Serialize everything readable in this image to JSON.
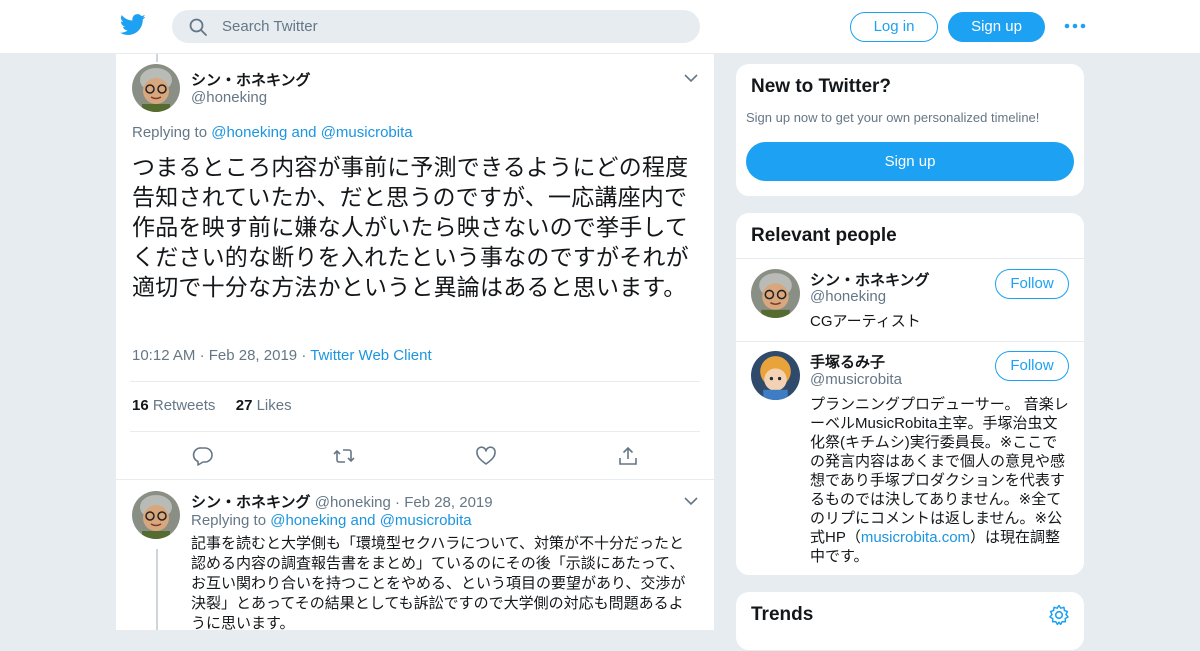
{
  "header": {
    "search_placeholder": "Search Twitter",
    "login_label": "Log in",
    "signup_label": "Sign up"
  },
  "tweet": {
    "name": "シン・ホネキング",
    "handle": "@honeking",
    "replying_prefix": "Replying to ",
    "replying_to": "@honeking and @musicrobita",
    "text": "つまるところ内容が事前に予測できるようにどの程度告知されていたか、だと思うのですが、一応講座内で作品を映す前に嫌な人がいたら映さないので挙手してください的な断りを入れたという事なのですがそれが適切で十分な方法かというと異論はあると思います。",
    "time": "10:12 AM",
    "date": "Feb 28, 2019",
    "client": "Twitter Web Client",
    "retweets_count": "16",
    "retweets_label": "Retweets",
    "likes_count": "27",
    "likes_label": "Likes"
  },
  "reply": {
    "name": "シン・ホネキング",
    "handle": "@honeking",
    "date": "Feb 28, 2019",
    "replying_prefix": "Replying to ",
    "replying_to": "@honeking and @musicrobita",
    "text": "記事を読むと大学側も「環境型セクハラについて、対策が不十分だったと認める内容の調査報告書をまとめ」ているのにその後「示談にあたって、お互い関わり合いを持つことをやめる、という項目の要望があり、交渉が決裂」とあってその結果としても訴訟ですので大学側の対応も問題あるように思います。"
  },
  "sidebar": {
    "new_title": "New to Twitter?",
    "new_subtitle": "Sign up now to get your own personalized timeline!",
    "new_signup": "Sign up",
    "relevant_title": "Relevant people",
    "people": [
      {
        "name": "シン・ホネキング",
        "handle": "@honeking",
        "bio": "CGアーティスト",
        "follow": "Follow"
      },
      {
        "name": "手塚るみ子",
        "handle": "@musicrobita",
        "bio_before": "プランニングプロデューサー。 音楽レーベルMusicRobita主宰。手塚治虫文化祭(キチムシ)実行委員長。※ここでの発言内容はあくまで個人の意見や感想であり手塚プロダクションを代表するものでは決してありません。※全てのリプにコメントは返しません。※公式HP（",
        "bio_link": "musicrobita.com",
        "bio_after": "）は現在調整中です。",
        "follow": "Follow"
      }
    ],
    "trends_title": "Trends"
  },
  "colors": {
    "brand": "#1da1f2",
    "link": "#1b95e0",
    "muted": "#657786",
    "background": "#e6ecf0"
  },
  "icons": [
    "twitter-bird-icon",
    "search-icon",
    "more-icon",
    "chevron-down-icon",
    "reply-icon",
    "retweet-icon",
    "like-icon",
    "share-icon",
    "gear-icon"
  ]
}
